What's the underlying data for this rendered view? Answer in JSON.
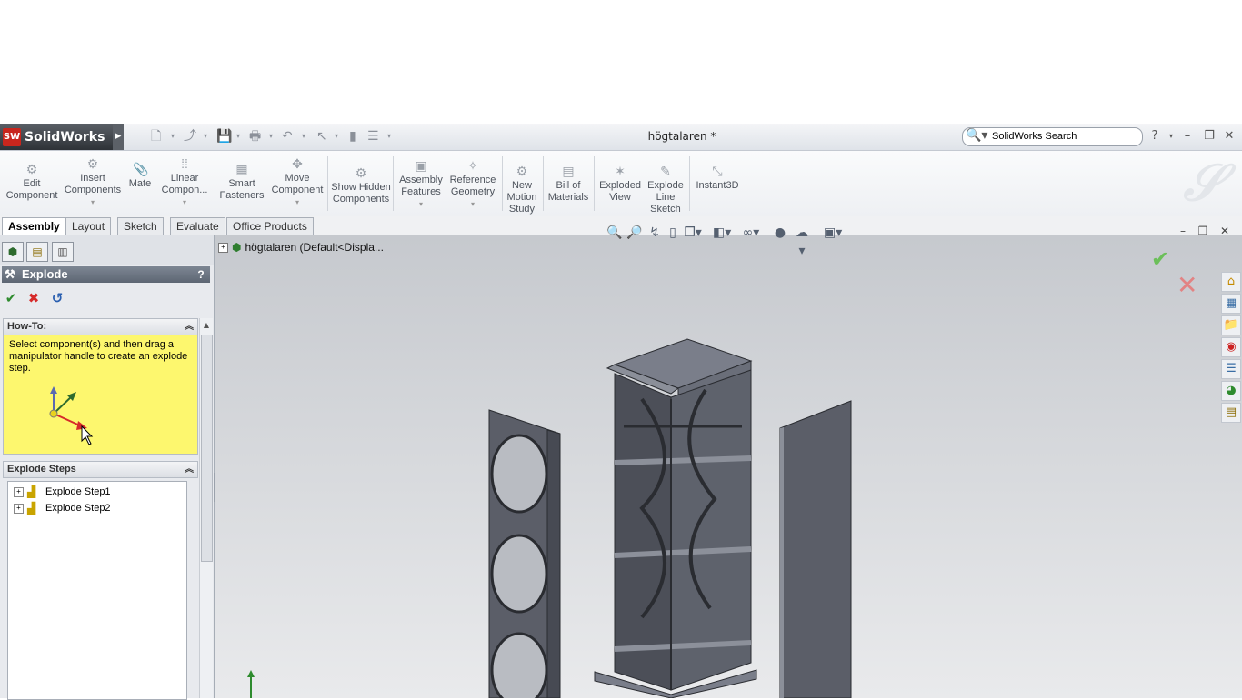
{
  "app": {
    "logo_text": "SolidWorks",
    "logo_badge": "SW",
    "document_title": "högtalaren *"
  },
  "search": {
    "placeholder": "SolidWorks Search",
    "value": "SolidWorks Search"
  },
  "window_controls": {
    "help": "?",
    "minimize": "–",
    "restore": "❐",
    "close": "✕"
  },
  "ribbon": {
    "buttons": [
      {
        "label": "Edit Component"
      },
      {
        "label": "Insert Components"
      },
      {
        "label": "Mate"
      },
      {
        "label": "Linear Compon..."
      },
      {
        "label": "Smart Fasteners"
      },
      {
        "label": "Move Component"
      },
      {
        "label": "Show Hidden Components"
      },
      {
        "label": "Assembly Features"
      },
      {
        "label": "Reference Geometry"
      },
      {
        "label": "New Motion Study"
      },
      {
        "label": "Bill of Materials"
      },
      {
        "label": "Exploded View"
      },
      {
        "label": "Explode Line Sketch"
      },
      {
        "label": "Instant3D"
      }
    ]
  },
  "tabs": [
    {
      "label": "Assembly",
      "active": true
    },
    {
      "label": "Layout"
    },
    {
      "label": "Sketch"
    },
    {
      "label": "Evaluate"
    },
    {
      "label": "Office Products"
    }
  ],
  "property_manager": {
    "title": "Explode",
    "help": "?",
    "howto": {
      "header": "How-To:",
      "text": "Select component(s) and then drag a manipulator handle to create an explode step."
    },
    "explode_steps": {
      "header": "Explode Steps",
      "items": [
        "Explode Step1",
        "Explode Step2"
      ]
    }
  },
  "feature_tree": {
    "root_label": "högtalaren  (Default<Displa..."
  },
  "colors": {
    "accent_green": "#2e8b2e",
    "cancel_red": "#d62a2a",
    "howto_bg": "#fdf76e"
  },
  "icons": {
    "ok": "check-icon",
    "cancel": "x-icon",
    "undo": "undo-icon"
  }
}
